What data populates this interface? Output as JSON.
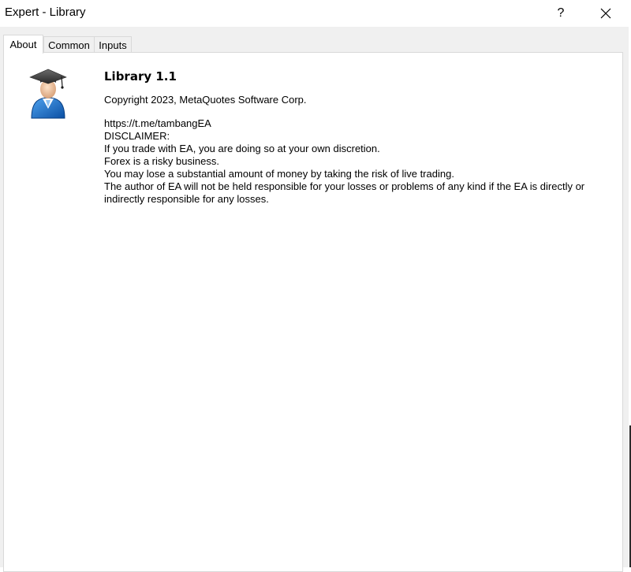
{
  "window": {
    "title": "Expert - Library",
    "help_label": "?"
  },
  "tabs": [
    {
      "label": "About",
      "active": true
    },
    {
      "label": "Common",
      "active": false
    },
    {
      "label": "Inputs",
      "active": false
    }
  ],
  "about": {
    "name": "Library 1.1",
    "copyright": "Copyright 2023, MetaQuotes Software Corp.",
    "description": [
      "https://t.me/tambangEA",
      "DISCLAIMER:",
      "If you trade with EA, you are doing so at your own discretion.",
      "Forex is a risky business.",
      "You may lose a substantial amount of money by taking the risk of live trading.",
      "The author of EA will not be held responsible for your losses or problems of any kind if the EA is directly or indirectly responsible for any losses."
    ],
    "icon": "expert-graduate-icon"
  },
  "colors": {
    "window_bg": "#f0f0f0",
    "panel_bg": "#ffffff",
    "border": "#d9d9d9",
    "icon_blue": "#1e6fc7"
  }
}
